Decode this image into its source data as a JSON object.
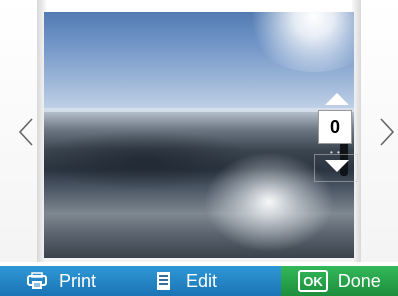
{
  "stepper": {
    "value": "0"
  },
  "toolbar": {
    "print_label": "Print",
    "edit_label": "Edit",
    "ok_badge": "OK",
    "done_label": "Done"
  },
  "icons": {
    "print": "printer-icon",
    "edit": "document-icon",
    "prev": "chevron-left-icon",
    "next": "chevron-right-icon",
    "up": "triangle-up-icon",
    "down": "triangle-down-icon"
  },
  "colors": {
    "toolbar_blue": "#2280c2",
    "toolbar_green": "#27a54b"
  }
}
